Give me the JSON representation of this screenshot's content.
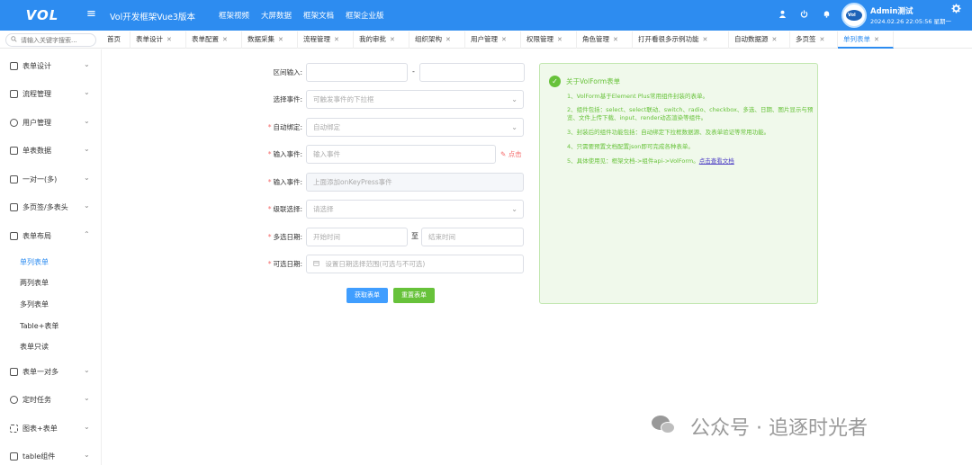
{
  "header": {
    "logo": "VOL",
    "menu_toggle": "≡",
    "app_title": "Vol开发框架Vue3版本",
    "nav": [
      "框架视频",
      "大屏数据",
      "框架文档",
      "框架企业版"
    ],
    "icons": [
      "user-icon",
      "power-icon",
      "bell-icon"
    ],
    "user_name": "Admin测试",
    "user_time": "2024.02.26 22:05:56 星期一",
    "avatar_text": "Vol",
    "settings_icon": "gear-icon"
  },
  "search": {
    "placeholder": "请输入关键字搜索..."
  },
  "tabs": [
    {
      "label": "首页",
      "closable": false
    },
    {
      "label": "表单设计",
      "closable": true
    },
    {
      "label": "表单配置",
      "closable": true
    },
    {
      "label": "数据采集",
      "closable": true
    },
    {
      "label": "流程管理",
      "closable": true
    },
    {
      "label": "我的审批",
      "closable": true
    },
    {
      "label": "组织架构",
      "closable": true
    },
    {
      "label": "用户管理",
      "closable": true
    },
    {
      "label": "权限管理",
      "closable": true
    },
    {
      "label": "角色管理",
      "closable": true
    },
    {
      "label": "打开看很多示例功能",
      "closable": true
    },
    {
      "label": "自动数据源",
      "closable": true
    },
    {
      "label": "多页签",
      "closable": true
    },
    {
      "label": "单列表单",
      "closable": true
    }
  ],
  "sidebar": {
    "items": [
      {
        "label": "表单设计"
      },
      {
        "label": "流程管理"
      },
      {
        "label": "用户管理"
      },
      {
        "label": "单表数据"
      },
      {
        "label": "一对一(多)"
      },
      {
        "label": "多页签/多表头"
      },
      {
        "label": "表单布局"
      }
    ],
    "sub_items": [
      "单列表单",
      "两列表单",
      "多列表单",
      "Table+表单",
      "表单只读"
    ],
    "items_after": [
      {
        "label": "表单一对多"
      },
      {
        "label": "定时任务"
      },
      {
        "label": "图表+表单"
      },
      {
        "label": "table组件"
      }
    ]
  },
  "form": {
    "range_label": "区间输入:",
    "range_sep": "-",
    "select_event_label": "选择事件:",
    "select_event_placeholder": "可触发事件的下拉框",
    "auto_bind_label": "自动绑定:",
    "auto_bind_placeholder": "自动绑定",
    "input_event_label": "输入事件:",
    "input_event_placeholder": "输入事件",
    "click_link": "点击",
    "input_event2_label": "输入事件:",
    "input_event2_placeholder": "上面添加onKeyPress事件",
    "cascade_label": "级联选择:",
    "cascade_placeholder": "请选择",
    "multi_date_label": "多选日期:",
    "start_placeholder": "开始时间",
    "date_sep": "至",
    "end_placeholder": "结束时间",
    "optional_date_label": "可选日期:",
    "optional_date_placeholder": "设置日期选择范围(可选与不可选)",
    "get_button": "获取表单",
    "reset_button": "重置表单"
  },
  "info": {
    "title": "关于VolForm表单",
    "lines": [
      "1、VolForm基于Element Plus常用组件封装的表单。",
      "2、组件包括：select、select联动、switch、radio、checkbox、多选、日期、图片显示与预览、文件上传下载、input、render动态渲染等组件。",
      "3、封装后的组件功能包括：自动绑定下拉框数据源、及表单验证等常用功能。",
      "4、只需要预置文档配置json即可完成各种表单。",
      "5、具体使用见：框架文档->组件api->VolForm。"
    ],
    "link": "点击查看文档"
  },
  "watermark": {
    "text": "公众号 · 追逐时光者",
    "icon": "wechat-icon"
  },
  "colors": {
    "primary": "#2d8cf0",
    "success": "#67c23a",
    "danger": "#f56c6c",
    "info_bg": "#f0f9eb"
  }
}
